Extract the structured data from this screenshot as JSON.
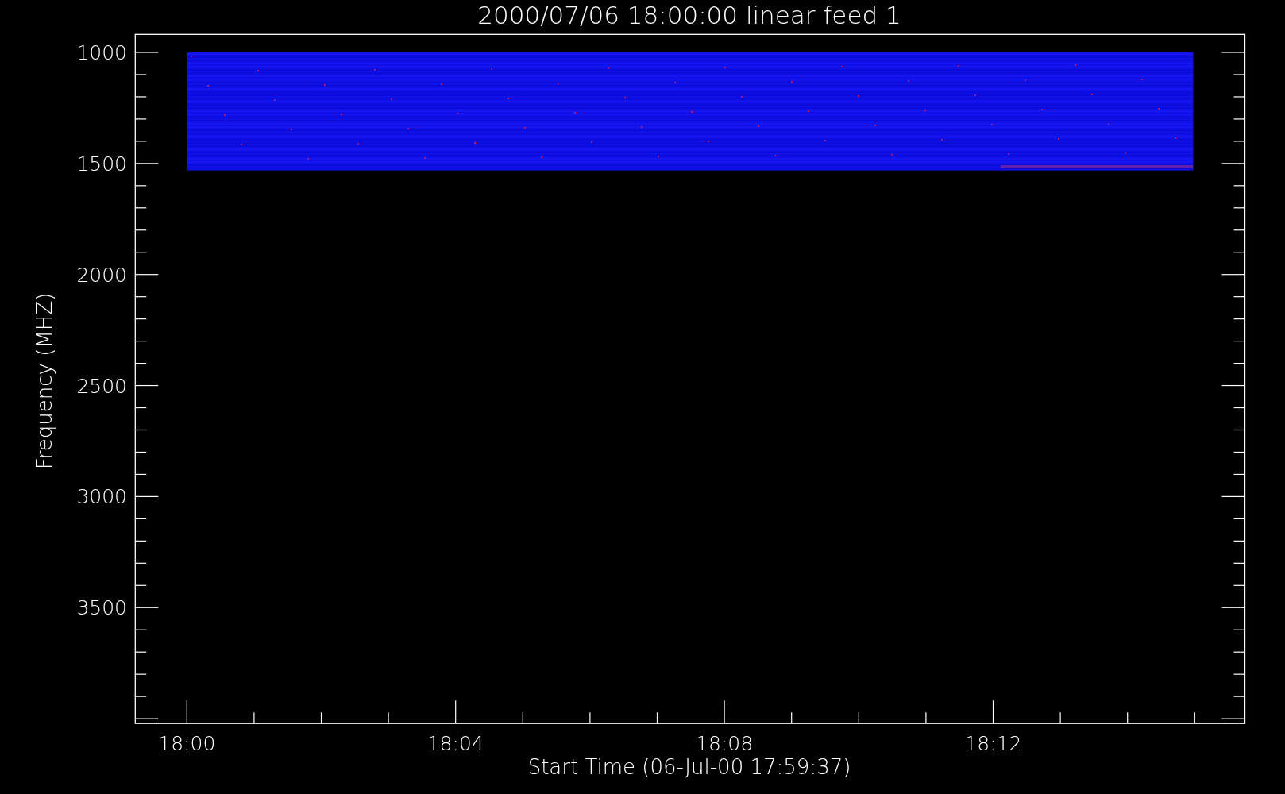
{
  "plot": {
    "title": "2000/07/06 18:00:00 linear feed 1",
    "y_axis": {
      "label": "Frequency (MHZ)",
      "ticks": [
        "1000",
        "1500",
        "2000",
        "2500",
        "3000",
        "3500"
      ]
    },
    "x_axis": {
      "label": "Start Time (06-Jul-00 17:59:37)",
      "ticks": [
        "18:00",
        "18:04",
        "18:08",
        "18:12"
      ]
    }
  }
}
